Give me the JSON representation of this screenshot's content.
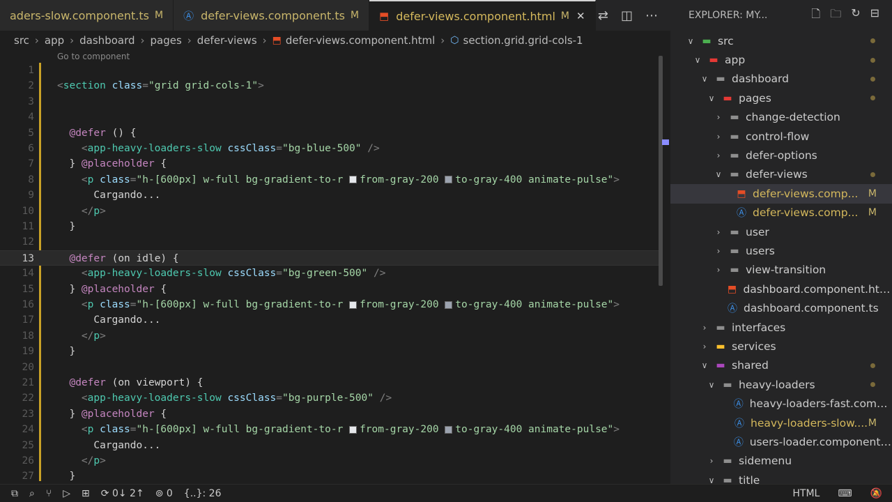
{
  "tabs": [
    {
      "label": "aders-slow.component.ts",
      "modified": "M",
      "icon": "angular-icon",
      "active": false
    },
    {
      "label": "defer-views.component.ts",
      "modified": "M",
      "icon": "angular-icon",
      "active": false
    },
    {
      "label": "defer-views.component.html",
      "modified": "M",
      "icon": "html-icon",
      "active": true,
      "close": "✕"
    }
  ],
  "breadcrumb": {
    "items": [
      "src",
      "app",
      "dashboard",
      "pages",
      "defer-views",
      "defer-views.component.html",
      "section.grid.grid-cols-1"
    ]
  },
  "codelens": "Go to component",
  "editor": {
    "current_line": 13,
    "lines": [
      {
        "n": "1",
        "html": ""
      },
      {
        "n": "2",
        "html": "<span class='t-punct'>&lt;</span><span class='t-tag'>section</span> <span class='t-attr'>class</span><span class='t-punct'>=</span><span class='t-str'>\"grid grid-cols-1\"</span><span class='t-punct'>&gt;</span>"
      },
      {
        "n": "3",
        "html": ""
      },
      {
        "n": "4",
        "html": ""
      },
      {
        "n": "5",
        "html": "  <span class='t-kw'>@defer</span> () {"
      },
      {
        "n": "6",
        "html": "    <span class='t-punct'>&lt;</span><span class='t-tag'>app-heavy-loaders-slow</span> <span class='t-attr'>cssClass</span><span class='t-punct'>=</span><span class='t-str'>\"bg-blue-500\"</span> <span class='t-punct'>/&gt;</span>"
      },
      {
        "n": "7",
        "html": "  } <span class='t-kw'>@placeholder</span> {"
      },
      {
        "n": "8",
        "html": "    <span class='t-punct'>&lt;</span><span class='t-tag'>p</span> <span class='t-attr'>class</span><span class='t-punct'>=</span><span class='t-str'>\"h-[600px] w-full bg-gradient-to-r <span class='sw' style='background:#e5e7eb'></span>from-gray-200 <span class='sw' style='background:#9ca3af'></span>to-gray-400 animate-pulse\"</span><span class='t-punct'>&gt;</span>"
      },
      {
        "n": "9",
        "html": "      Cargando..."
      },
      {
        "n": "10",
        "html": "    <span class='t-punct'>&lt;/</span><span class='t-tag'>p</span><span class='t-punct'>&gt;</span>"
      },
      {
        "n": "11",
        "html": "  }"
      },
      {
        "n": "12",
        "html": ""
      },
      {
        "n": "13",
        "html": "  <span class='t-kw'>@defer</span> (on idle) {"
      },
      {
        "n": "14",
        "html": "    <span class='t-punct'>&lt;</span><span class='t-tag'>app-heavy-loaders-slow</span> <span class='t-attr'>cssClass</span><span class='t-punct'>=</span><span class='t-str'>\"bg-green-500\"</span> <span class='t-punct'>/&gt;</span>"
      },
      {
        "n": "15",
        "html": "  } <span class='t-kw'>@placeholder</span> {"
      },
      {
        "n": "16",
        "html": "    <span class='t-punct'>&lt;</span><span class='t-tag'>p</span> <span class='t-attr'>class</span><span class='t-punct'>=</span><span class='t-str'>\"h-[600px] w-full bg-gradient-to-r <span class='sw' style='background:#e5e7eb'></span>from-gray-200 <span class='sw' style='background:#9ca3af'></span>to-gray-400 animate-pulse\"</span><span class='t-punct'>&gt;</span>"
      },
      {
        "n": "17",
        "html": "      Cargando..."
      },
      {
        "n": "18",
        "html": "    <span class='t-punct'>&lt;/</span><span class='t-tag'>p</span><span class='t-punct'>&gt;</span>"
      },
      {
        "n": "19",
        "html": "  }"
      },
      {
        "n": "20",
        "html": ""
      },
      {
        "n": "21",
        "html": "  <span class='t-kw'>@defer</span> (on viewport) {"
      },
      {
        "n": "22",
        "html": "    <span class='t-punct'>&lt;</span><span class='t-tag'>app-heavy-loaders-slow</span> <span class='t-attr'>cssClass</span><span class='t-punct'>=</span><span class='t-str'>\"bg-purple-500\"</span> <span class='t-punct'>/&gt;</span>"
      },
      {
        "n": "23",
        "html": "  } <span class='t-kw'>@placeholder</span> {"
      },
      {
        "n": "24",
        "html": "    <span class='t-punct'>&lt;</span><span class='t-tag'>p</span> <span class='t-attr'>class</span><span class='t-punct'>=</span><span class='t-str'>\"h-[600px] w-full bg-gradient-to-r <span class='sw' style='background:#e5e7eb'></span>from-gray-200 <span class='sw' style='background:#9ca3af'></span>to-gray-400 animate-pulse\"</span><span class='t-punct'>&gt;</span>"
      },
      {
        "n": "25",
        "html": "      Cargando..."
      },
      {
        "n": "26",
        "html": "    <span class='t-punct'>&lt;/</span><span class='t-tag'>p</span><span class='t-punct'>&gt;</span>"
      },
      {
        "n": "27",
        "html": "  }"
      }
    ]
  },
  "explorer": {
    "title": "EXPLORER: MY...",
    "rows": [
      {
        "depth": 1,
        "chev": "∨",
        "icon": "folder-src",
        "label": "src",
        "dot": true
      },
      {
        "depth": 2,
        "chev": "∨",
        "icon": "folder-app",
        "label": "app",
        "dot": true
      },
      {
        "depth": 3,
        "chev": "∨",
        "icon": "folder",
        "label": "dashboard",
        "dot": true
      },
      {
        "depth": 4,
        "chev": "∨",
        "icon": "folder-pages",
        "label": "pages",
        "dot": true
      },
      {
        "depth": 5,
        "chev": "›",
        "icon": "folder",
        "label": "change-detection"
      },
      {
        "depth": 5,
        "chev": "›",
        "icon": "folder",
        "label": "control-flow"
      },
      {
        "depth": 5,
        "chev": "›",
        "icon": "folder",
        "label": "defer-options"
      },
      {
        "depth": 5,
        "chev": "∨",
        "icon": "folder",
        "label": "defer-views",
        "dot": true
      },
      {
        "depth": 6,
        "chev": "",
        "icon": "html",
        "label": "defer-views.comp...",
        "mod": "M",
        "sel": true
      },
      {
        "depth": 6,
        "chev": "",
        "icon": "angular",
        "label": "defer-views.comp...",
        "mod": "M"
      },
      {
        "depth": 5,
        "chev": "›",
        "icon": "folder",
        "label": "user"
      },
      {
        "depth": 5,
        "chev": "›",
        "icon": "folder",
        "label": "users"
      },
      {
        "depth": 5,
        "chev": "›",
        "icon": "folder",
        "label": "view-transition"
      },
      {
        "depth": 4.7,
        "chev": "",
        "icon": "html",
        "label": "dashboard.component.html"
      },
      {
        "depth": 4.7,
        "chev": "",
        "icon": "angular",
        "label": "dashboard.component.ts"
      },
      {
        "depth": 3,
        "chev": "›",
        "icon": "folder",
        "label": "interfaces"
      },
      {
        "depth": 3,
        "chev": "›",
        "icon": "folder-services",
        "label": "services"
      },
      {
        "depth": 3,
        "chev": "∨",
        "icon": "folder-shared",
        "label": "shared",
        "dot": true
      },
      {
        "depth": 4,
        "chev": "∨",
        "icon": "folder",
        "label": "heavy-loaders",
        "dot": true
      },
      {
        "depth": 5.7,
        "chev": "",
        "icon": "angular",
        "label": "heavy-loaders-fast.comp..."
      },
      {
        "depth": 5.7,
        "chev": "",
        "icon": "angular",
        "label": "heavy-loaders-slow....",
        "mod": "M"
      },
      {
        "depth": 5.7,
        "chev": "",
        "icon": "angular",
        "label": "users-loader.component.ts"
      },
      {
        "depth": 4,
        "chev": "›",
        "icon": "folder",
        "label": "sidemenu"
      },
      {
        "depth": 4,
        "chev": "∨",
        "icon": "folder",
        "label": "title"
      }
    ]
  },
  "statusbar": {
    "sync": "0↓ 2↑",
    "ports": "0",
    "selection": "{..}: 26",
    "language": "HTML"
  }
}
